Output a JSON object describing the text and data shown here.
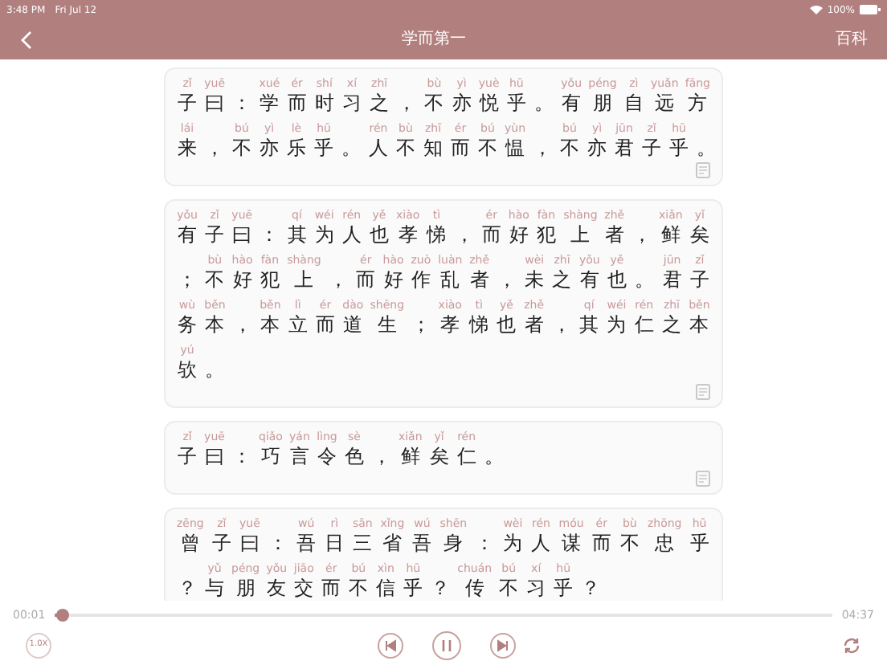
{
  "status_bar": {
    "time": "3:48 PM",
    "date": "Fri Jul 12",
    "battery": "100%"
  },
  "nav": {
    "title": "学而第一",
    "action": "百科"
  },
  "cards": [
    {
      "lines": [
        {
          "tokens": [
            {
              "pinyin": "zǐ",
              "char": "子"
            },
            {
              "pinyin": "yuē",
              "char": "曰"
            },
            {
              "char": "："
            },
            {
              "pinyin": "xué",
              "char": "学"
            },
            {
              "pinyin": "ér",
              "char": "而"
            },
            {
              "pinyin": "shí",
              "char": "时"
            },
            {
              "pinyin": "xí",
              "char": "习"
            },
            {
              "pinyin": "zhī",
              "char": "之"
            },
            {
              "char": "，"
            },
            {
              "pinyin": "bù",
              "char": "不"
            },
            {
              "pinyin": "yì",
              "char": "亦"
            },
            {
              "pinyin": "yuè",
              "char": "悦"
            },
            {
              "pinyin": "hū",
              "char": "乎"
            },
            {
              "char": "。"
            },
            {
              "pinyin": "yǒu",
              "char": "有"
            },
            {
              "pinyin": "péng",
              "char": "朋"
            },
            {
              "pinyin": "zì",
              "char": "自"
            },
            {
              "pinyin": "yuǎn",
              "char": "远"
            },
            {
              "pinyin": "fāng",
              "char": "方"
            }
          ]
        },
        {
          "tokens": [
            {
              "pinyin": "lái",
              "char": "来"
            },
            {
              "char": "，"
            },
            {
              "pinyin": "bú",
              "char": "不"
            },
            {
              "pinyin": "yì",
              "char": "亦"
            },
            {
              "pinyin": "lè",
              "char": "乐"
            },
            {
              "pinyin": "hū",
              "char": "乎"
            },
            {
              "char": "。"
            },
            {
              "pinyin": "rén",
              "char": "人"
            },
            {
              "pinyin": "bù",
              "char": "不"
            },
            {
              "pinyin": "zhī",
              "char": "知"
            },
            {
              "pinyin": "ér",
              "char": "而"
            },
            {
              "pinyin": "bú",
              "char": "不"
            },
            {
              "pinyin": "yùn",
              "char": "愠"
            },
            {
              "char": "，"
            },
            {
              "pinyin": "bú",
              "char": "不"
            },
            {
              "pinyin": "yì",
              "char": "亦"
            },
            {
              "pinyin": "jūn",
              "char": "君"
            },
            {
              "pinyin": "zǐ",
              "char": "子"
            },
            {
              "pinyin": "hū",
              "char": "乎"
            },
            {
              "char": "。"
            }
          ]
        }
      ],
      "note_icon": true
    },
    {
      "lines": [
        {
          "tokens": [
            {
              "pinyin": "yǒu",
              "char": "有"
            },
            {
              "pinyin": "zǐ",
              "char": "子"
            },
            {
              "pinyin": "yuē",
              "char": "曰"
            },
            {
              "char": "："
            },
            {
              "pinyin": "qí",
              "char": "其"
            },
            {
              "pinyin": "wéi",
              "char": "为"
            },
            {
              "pinyin": "rén",
              "char": "人"
            },
            {
              "pinyin": "yě",
              "char": "也"
            },
            {
              "pinyin": "xiào",
              "char": "孝"
            },
            {
              "pinyin": "tì",
              "char": "悌"
            },
            {
              "char": "，"
            },
            {
              "pinyin": "ér",
              "char": "而"
            },
            {
              "pinyin": "hào",
              "char": "好"
            },
            {
              "pinyin": "fàn",
              "char": "犯"
            },
            {
              "pinyin": "shàng",
              "char": "上"
            },
            {
              "pinyin": "zhě",
              "char": "者"
            },
            {
              "char": "，"
            },
            {
              "pinyin": "xiǎn",
              "char": "鲜"
            },
            {
              "pinyin": "yǐ",
              "char": "矣"
            }
          ]
        },
        {
          "tokens": [
            {
              "char": "；"
            },
            {
              "pinyin": "bù",
              "char": "不"
            },
            {
              "pinyin": "hào",
              "char": "好"
            },
            {
              "pinyin": "fàn",
              "char": "犯"
            },
            {
              "pinyin": "shàng",
              "char": "上"
            },
            {
              "char": "，"
            },
            {
              "pinyin": "ér",
              "char": "而"
            },
            {
              "pinyin": "hào",
              "char": "好"
            },
            {
              "pinyin": "zuò",
              "char": "作"
            },
            {
              "pinyin": "luàn",
              "char": "乱"
            },
            {
              "pinyin": "zhě",
              "char": "者"
            },
            {
              "char": "，"
            },
            {
              "pinyin": "wèi",
              "char": "未"
            },
            {
              "pinyin": "zhī",
              "char": "之"
            },
            {
              "pinyin": "yǒu",
              "char": "有"
            },
            {
              "pinyin": "yě",
              "char": "也"
            },
            {
              "char": "。"
            },
            {
              "pinyin": "jūn",
              "char": "君"
            },
            {
              "pinyin": "zǐ",
              "char": "子"
            }
          ]
        },
        {
          "tokens": [
            {
              "pinyin": "wù",
              "char": "务"
            },
            {
              "pinyin": "běn",
              "char": "本"
            },
            {
              "char": "，"
            },
            {
              "pinyin": "běn",
              "char": "本"
            },
            {
              "pinyin": "lì",
              "char": "立"
            },
            {
              "pinyin": "ér",
              "char": "而"
            },
            {
              "pinyin": "dào",
              "char": "道"
            },
            {
              "pinyin": "shēng",
              "char": "生"
            },
            {
              "char": "；"
            },
            {
              "pinyin": "xiào",
              "char": "孝"
            },
            {
              "pinyin": "tì",
              "char": "悌"
            },
            {
              "pinyin": "yě",
              "char": "也"
            },
            {
              "pinyin": "zhě",
              "char": "者"
            },
            {
              "char": "，"
            },
            {
              "pinyin": "qí",
              "char": "其"
            },
            {
              "pinyin": "wéi",
              "char": "为"
            },
            {
              "pinyin": "rén",
              "char": "仁"
            },
            {
              "pinyin": "zhī",
              "char": "之"
            },
            {
              "pinyin": "běn",
              "char": "本"
            }
          ]
        },
        {
          "tokens": [
            {
              "pinyin": "yú",
              "char": "欤"
            },
            {
              "char": "。"
            }
          ]
        }
      ],
      "note_icon": true
    },
    {
      "lines": [
        {
          "tokens": [
            {
              "pinyin": "zǐ",
              "char": "子"
            },
            {
              "pinyin": "yuē",
              "char": "曰"
            },
            {
              "char": "："
            },
            {
              "pinyin": "qiǎo",
              "char": "巧"
            },
            {
              "pinyin": "yán",
              "char": "言"
            },
            {
              "pinyin": "lìng",
              "char": "令"
            },
            {
              "pinyin": "sè",
              "char": "色"
            },
            {
              "char": "，"
            },
            {
              "pinyin": "xiǎn",
              "char": "鲜"
            },
            {
              "pinyin": "yǐ",
              "char": "矣"
            },
            {
              "pinyin": "rén",
              "char": "仁"
            },
            {
              "char": "。"
            }
          ]
        }
      ],
      "note_icon": true
    },
    {
      "lines": [
        {
          "tokens": [
            {
              "pinyin": "zēng",
              "char": "曾"
            },
            {
              "pinyin": "zǐ",
              "char": "子"
            },
            {
              "pinyin": "yuē",
              "char": "曰"
            },
            {
              "char": "："
            },
            {
              "pinyin": "wú",
              "char": "吾"
            },
            {
              "pinyin": "rì",
              "char": "日"
            },
            {
              "pinyin": "sān",
              "char": "三"
            },
            {
              "pinyin": "xǐng",
              "char": "省"
            },
            {
              "pinyin": "wú",
              "char": "吾"
            },
            {
              "pinyin": "shēn",
              "char": "身"
            },
            {
              "char": "："
            },
            {
              "pinyin": "wèi",
              "char": "为"
            },
            {
              "pinyin": "rén",
              "char": "人"
            },
            {
              "pinyin": "móu",
              "char": "谋"
            },
            {
              "pinyin": "ér",
              "char": "而"
            },
            {
              "pinyin": "bù",
              "char": "不"
            },
            {
              "pinyin": "zhōng",
              "char": "忠"
            },
            {
              "pinyin": "hū",
              "char": "乎"
            }
          ]
        },
        {
          "tokens": [
            {
              "char": "？"
            },
            {
              "pinyin": "yǔ",
              "char": "与"
            },
            {
              "pinyin": "péng",
              "char": "朋"
            },
            {
              "pinyin": "yǒu",
              "char": "友"
            },
            {
              "pinyin": "jiāo",
              "char": "交"
            },
            {
              "pinyin": "ér",
              "char": "而"
            },
            {
              "pinyin": "bú",
              "char": "不"
            },
            {
              "pinyin": "xìn",
              "char": "信"
            },
            {
              "pinyin": "hū",
              "char": "乎"
            },
            {
              "char": "？"
            },
            {
              "pinyin": "chuán",
              "char": "传"
            },
            {
              "pinyin": "bú",
              "char": "不"
            },
            {
              "pinyin": "xí",
              "char": "习"
            },
            {
              "pinyin": "hū",
              "char": "乎"
            },
            {
              "char": "？"
            }
          ]
        }
      ],
      "note_icon": false
    }
  ],
  "player": {
    "elapsed": "00:01",
    "total": "04:37",
    "level": 0.01,
    "speed": "1.0X",
    "playing": true
  }
}
